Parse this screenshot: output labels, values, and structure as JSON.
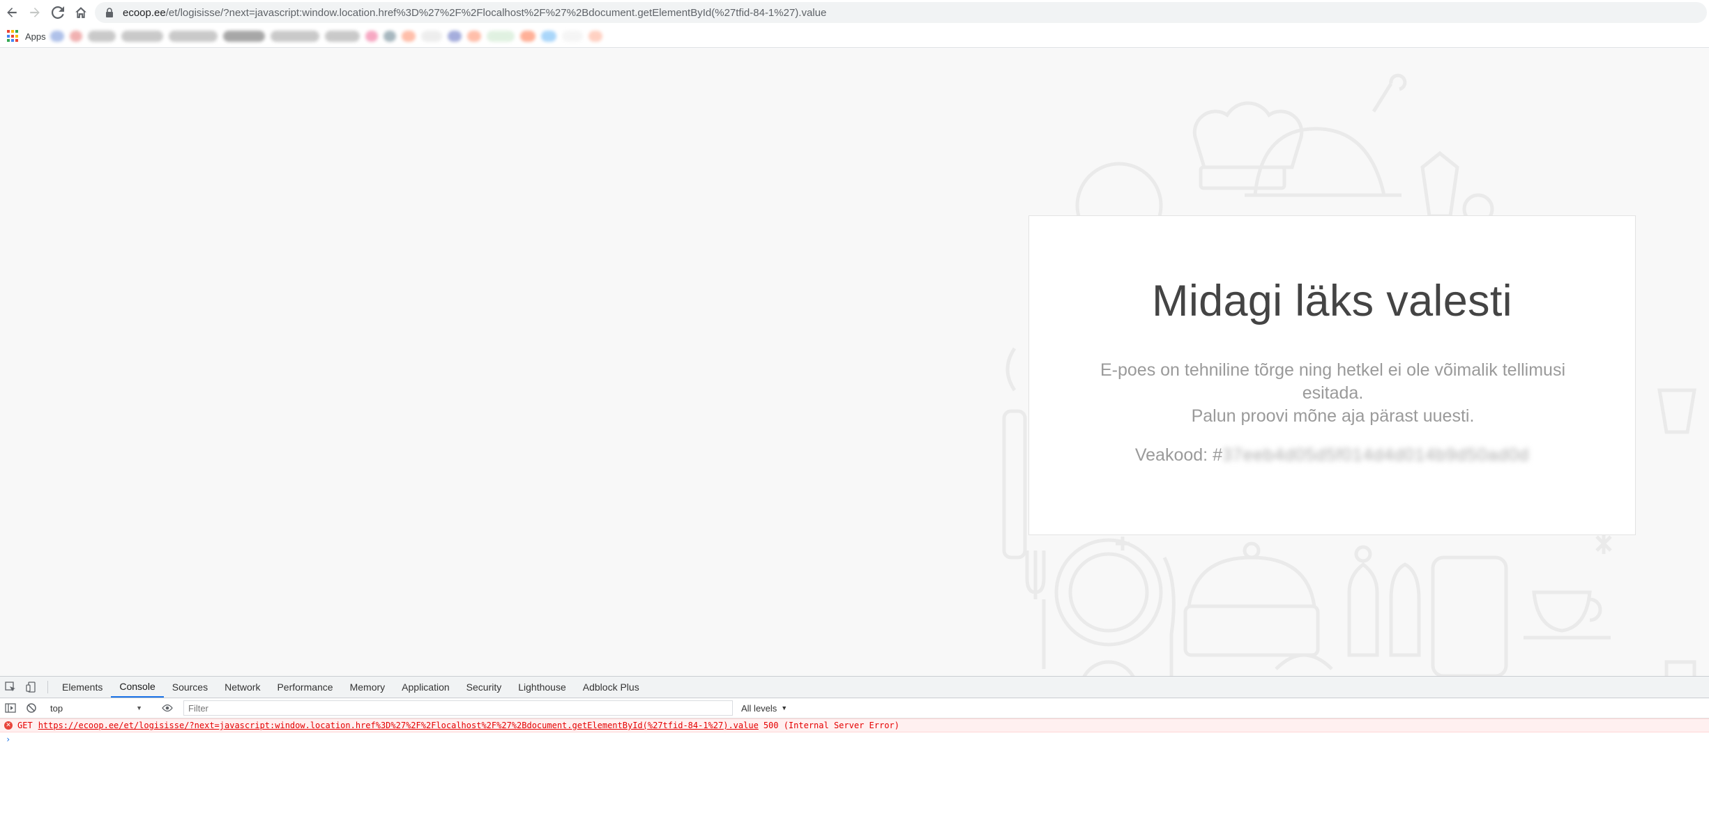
{
  "browser": {
    "omnibox": {
      "host": "ecoop.ee",
      "path": "/et/logisisse/?next=javascript:window.location.href%3D%27%2F%2Flocalhost%2F%27%2Bdocument.getElementById(%27tfid-84-1%27).value"
    },
    "bookmarks": {
      "apps_label": "Apps"
    }
  },
  "page": {
    "error_title": "Midagi läks valesti",
    "error_message_line1": "E-poes on tehniline tõrge ning hetkel ei ole võimalik tellimusi esitada.",
    "error_message_line2": "Palun proovi mõne aja pärast uuesti.",
    "error_code_label": "Veakood: #",
    "error_code_value": "37eeb4d05d5f014d4d014b9d50ad0d"
  },
  "devtools": {
    "tabs": [
      "Elements",
      "Console",
      "Sources",
      "Network",
      "Performance",
      "Memory",
      "Application",
      "Security",
      "Lighthouse",
      "Adblock Plus"
    ],
    "active_tab": "Console",
    "context": "top",
    "filter_placeholder": "Filter",
    "levels_label": "All levels",
    "console_error": {
      "method": "GET",
      "url": "https://ecoop.ee/et/logisisse/?next=javascript:window.location.href%3D%27%2F%2Flocalhost%2F%27%2Bdocument.getElementById(%27tfid-84-1%27).value",
      "status": "500 (Internal Server Error)"
    },
    "prompt": "›"
  },
  "colors": {
    "accent": "#1a73e8",
    "error": "#e50000",
    "page_bg": "#f8f8f8"
  }
}
